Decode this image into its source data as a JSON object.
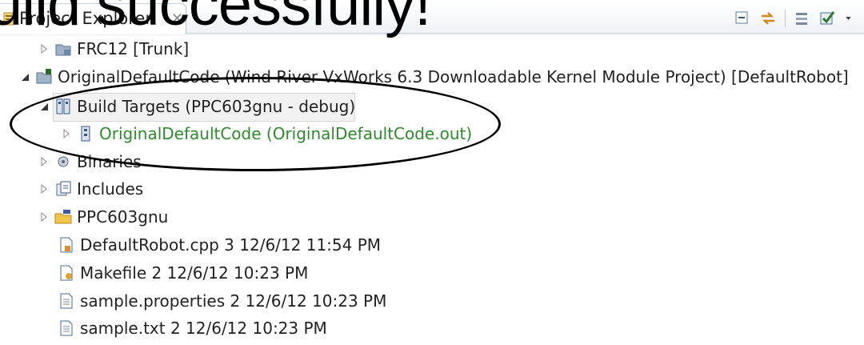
{
  "overlay_text": "uild successfully!",
  "panel": {
    "tab_label": "Project Explorer",
    "close_glyph": "✕",
    "toolbar": [
      "collapse-all-icon",
      "link-with-editor-icon",
      "filter-icon",
      "focus-task-icon",
      "view-menu-icon"
    ]
  },
  "tree": {
    "frc12": "FRC12 [Trunk]",
    "project": "OriginalDefaultCode (Wind River VxWorks 6.3 Downloadable Kernel Module Project) [DefaultRobot]",
    "build_targets": "Build Targets (PPC603gnu - debug)",
    "target_item": "OriginalDefaultCode (OriginalDefaultCode.out)",
    "binaries": "Binaries",
    "includes": "Includes",
    "ppc_folder": "PPC603gnu",
    "file_cpp": "DefaultRobot.cpp 3  12/6/12 11:54 PM",
    "file_makefile": "Makefile 2  12/6/12 10:23 PM",
    "file_properties": "sample.properties 2  12/6/12 10:23 PM",
    "file_txt": "sample.txt 2  12/6/12 10:23 PM"
  },
  "colors": {
    "highlight_text": "#2d8b2d",
    "annotation": "#000000"
  }
}
